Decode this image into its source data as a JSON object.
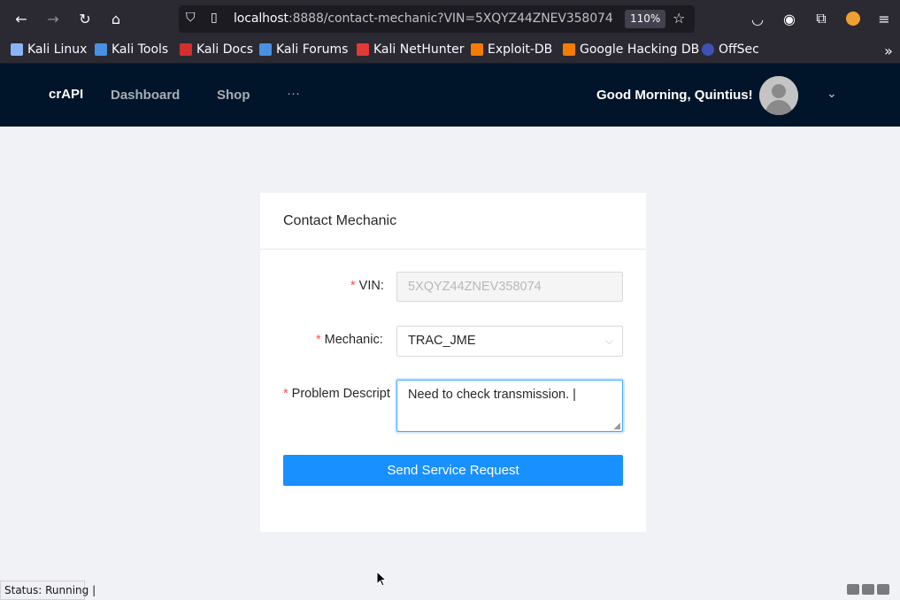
{
  "browser": {
    "url_host": "localhost",
    "url_rest": ":8888/contact-mechanic?VIN=5XQYZ44ZNEV358074",
    "zoom": "110%"
  },
  "bookmarks": [
    {
      "label": "Kali Linux",
      "color": "#367bf0"
    },
    {
      "label": "Kali Tools",
      "color": "#4a90e2"
    },
    {
      "label": "Kali Docs",
      "color": "#d32f2f"
    },
    {
      "label": "Kali Forums",
      "color": "#4a90e2"
    },
    {
      "label": "Kali NetHunter",
      "color": "#e53935"
    },
    {
      "label": "Exploit-DB",
      "color": "#f57c00"
    },
    {
      "label": "Google Hacking DB",
      "color": "#f57c00"
    },
    {
      "label": "OffSec",
      "color": "#3f51b5"
    }
  ],
  "header": {
    "brand": "crAPI",
    "nav": [
      "Dashboard",
      "Shop",
      "···"
    ],
    "greeting": "Good Morning, Quintius!"
  },
  "form": {
    "title": "Contact Mechanic",
    "vin_label": "VIN",
    "vin_value": "5XQYZ44ZNEV358074",
    "mechanic_label": "Mechanic",
    "mechanic_value": "TRAC_JME",
    "problem_label": "Problem Descript",
    "problem_value": "Need to check transmission. |",
    "submit_label": "Send Service Request"
  },
  "status": {
    "text": "Status: Running"
  }
}
